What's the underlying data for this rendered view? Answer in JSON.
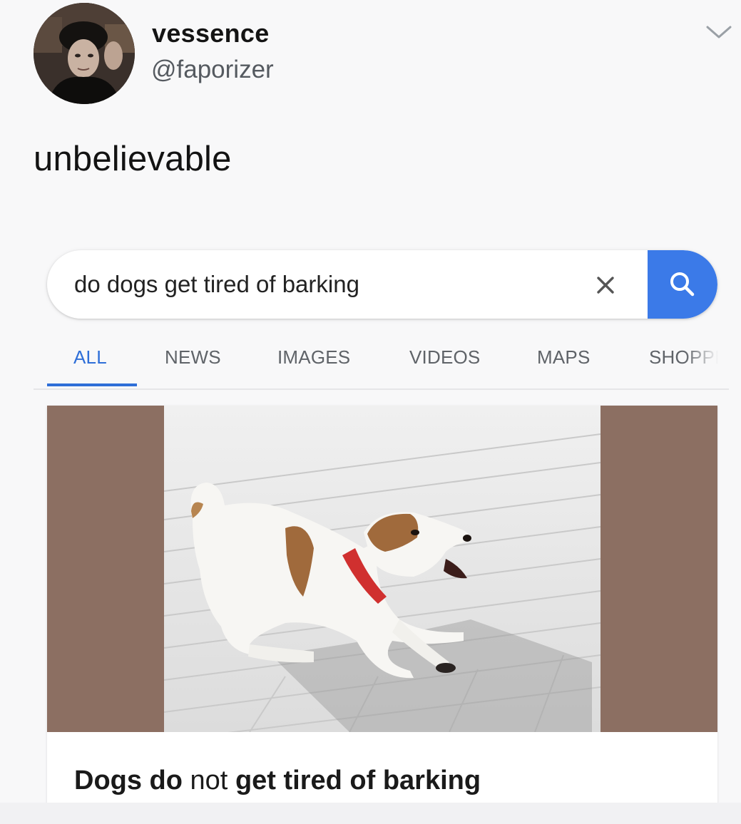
{
  "tweet": {
    "display_name": "vessence",
    "handle": "@faporizer",
    "text": "unbelievable",
    "menu_icon": "chevron-down-icon"
  },
  "search": {
    "query": "do dogs get tired of barking",
    "clear_icon": "close-icon",
    "search_icon": "search-icon",
    "accent": "#3b7ae8"
  },
  "tabs": [
    {
      "label": "ALL",
      "active": true
    },
    {
      "label": "NEWS",
      "active": false
    },
    {
      "label": "IMAGES",
      "active": false
    },
    {
      "label": "VIDEOS",
      "active": false
    },
    {
      "label": "MAPS",
      "active": false
    },
    {
      "label": "SHOPPI",
      "active": false
    }
  ],
  "result": {
    "image_subject": "dog-photo",
    "side_color": "#8c6f62",
    "title_parts": [
      {
        "text": "Dogs do",
        "bold": true
      },
      {
        "text": " not ",
        "bold": false
      },
      {
        "text": "get tired of barking",
        "bold": true
      }
    ]
  }
}
